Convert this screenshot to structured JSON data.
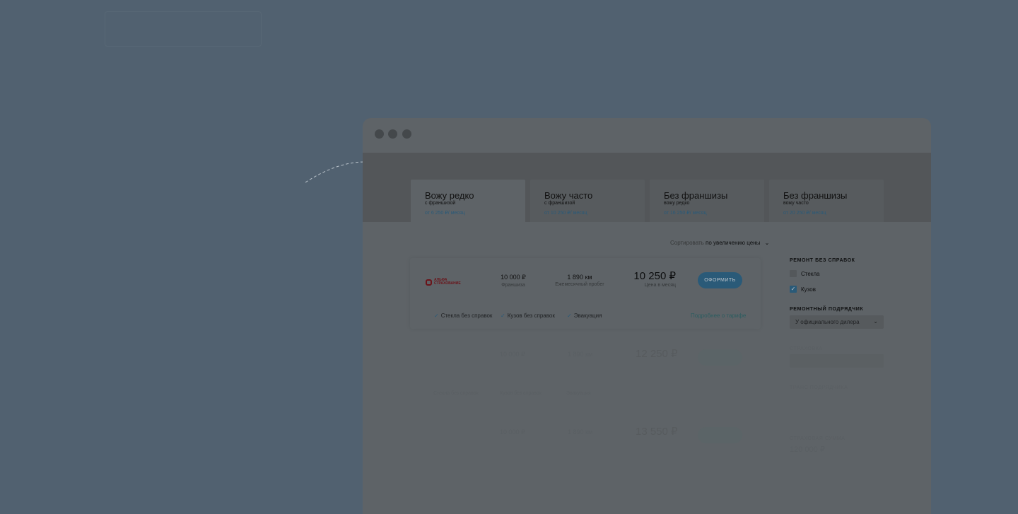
{
  "window_dots": [
    "dot-1",
    "dot-2",
    "dot-3"
  ],
  "tabs": [
    {
      "title": "Вожу редко",
      "subtitle": "с франшизой",
      "price": "от 6 250 ₽/ месяц"
    },
    {
      "title": "Вожу часто",
      "subtitle": "с франшизой",
      "price": "от 10 250 ₽/ месяц"
    },
    {
      "title": "Без франшизы",
      "subtitle": "вожу редко",
      "price": "от 16 250 ₽/ месяц"
    },
    {
      "title": "Без франшизы",
      "subtitle": "вожу часто",
      "price": "от 20 250 ₽/ месяц"
    }
  ],
  "sort": {
    "label": "Сортировать",
    "value": "по увеличению цены",
    "icon": "chevron-down-icon"
  },
  "offer": {
    "logo_text": [
      "АЛЬФА",
      "СТРАХОВАНИЕ"
    ],
    "franchise_value": "10 000 ₽",
    "franchise_label": "Франшиза",
    "mileage_value": "1 890 км",
    "mileage_label": "Ежемесячный пробег",
    "price": "10 250 ₽",
    "price_label": "Цена в месяц",
    "button": "ОФОРМИТЬ",
    "features": [
      "Стекла без справок",
      "Кузов без справок",
      "Эвакуация"
    ],
    "more_link": "Подробнее о тарифе"
  },
  "ghost_offers": [
    {
      "franchise": "10 000 ₽",
      "mileage": "1 890 км",
      "price": "12 250 ₽"
    },
    {
      "franchise": "10 000 ₽",
      "mileage": "1 890 км",
      "price": "13 550 ₽"
    }
  ],
  "ghost_features": [
    "Стекла без справок",
    "Кузов без справок",
    "Эвакуация"
  ],
  "sidebar": {
    "repair_title": "РЕМОНТ БЕЗ СПРАВОК",
    "options": [
      {
        "label": "Стекла",
        "checked": false
      },
      {
        "label": "Кузов",
        "checked": true
      }
    ],
    "contractor_title": "РЕМОНТНЫЙ ПОДРЯДЧИК",
    "contractor_value": "У официального дилера",
    "insurance_title": "СТРАХОВКА",
    "installment_title": "ТРАНС ПОДРЯДЧИКА",
    "sum_title": "СТРАХОВАЯ СУММА",
    "sum_value": "120 000 ₽"
  },
  "colors": {
    "accent": "#2a5a78",
    "brand": "#6a1319",
    "overlay": "#516170"
  }
}
